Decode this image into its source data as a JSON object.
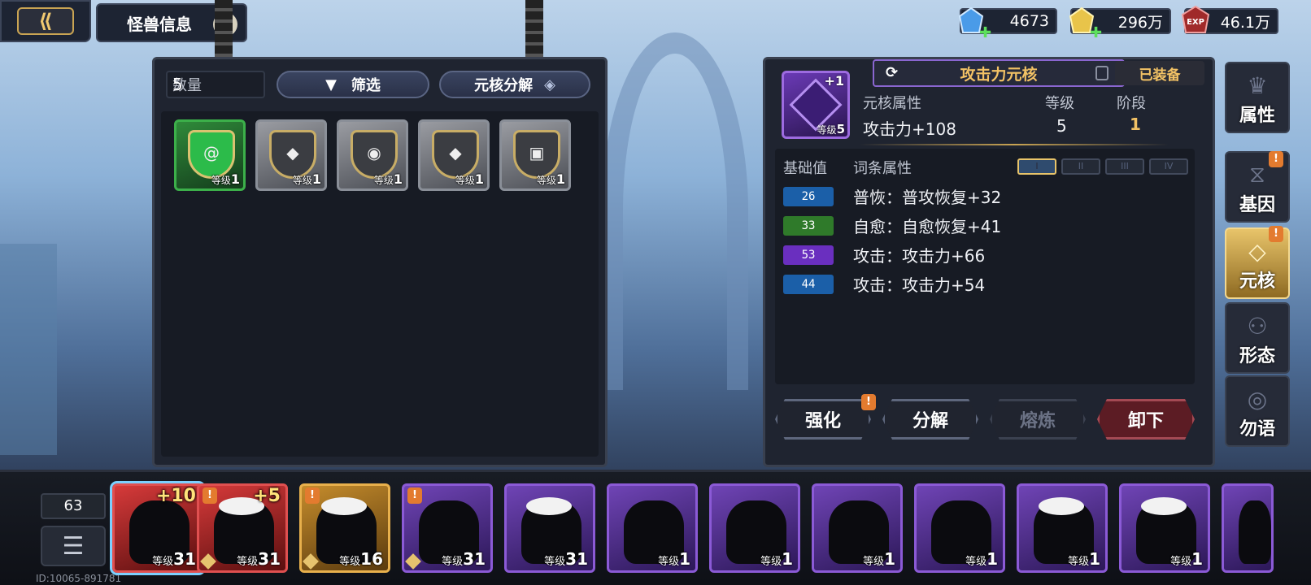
{
  "header": {
    "back_icon": "back-arrow-icon",
    "title": "怪兽信息",
    "info_icon": "i"
  },
  "currencies": [
    {
      "icon": "diamond-gem-icon",
      "value": "4673",
      "color": "#4a9be8"
    },
    {
      "icon": "gold-coin-icon",
      "value": "296万",
      "color": "#e8c44a"
    },
    {
      "icon": "EXP",
      "value": "46.1万",
      "color": "#c23a3a"
    }
  ],
  "inventory": {
    "qty_label": "数量",
    "qty_value": "5",
    "filter_label": "筛选",
    "decompose_label": "元核分解",
    "items": [
      {
        "type": "green",
        "emblem": "@",
        "lv_label": "等级",
        "lv": "1"
      },
      {
        "type": "grey",
        "emblem": "◆",
        "lv_label": "等级",
        "lv": "1"
      },
      {
        "type": "grey",
        "emblem": "◉",
        "lv_label": "等级",
        "lv": "1"
      },
      {
        "type": "grey",
        "emblem": "◆",
        "lv_label": "等级",
        "lv": "1"
      },
      {
        "type": "grey",
        "emblem": "▣",
        "lv_label": "等级",
        "lv": "1"
      }
    ]
  },
  "detail": {
    "core_name": "攻击力元核",
    "equipped_label": "已装备",
    "core_plus": "+1",
    "core_lv_label": "等级",
    "core_lv": "5",
    "attr_header": "元核属性",
    "level_header": "等级",
    "stage_header": "阶段",
    "attr_value": "攻击力+108",
    "level_value": "5",
    "stage_value": "1",
    "base_header": "基础值",
    "affix_header": "词条属性",
    "tiers": [
      "I",
      "II",
      "III",
      "IV"
    ],
    "affixes": [
      {
        "base": "26",
        "color": "#1b5fa8",
        "text": "普恢：普攻恢复+32"
      },
      {
        "base": "33",
        "color": "#2f7a2a",
        "text": "自愈：自愈恢复+41"
      },
      {
        "base": "53",
        "color": "#6a2fbf",
        "text": "攻击：攻击力+66"
      },
      {
        "base": "44",
        "color": "#1b5fa8",
        "text": "攻击：攻击力+54"
      }
    ],
    "buttons": {
      "strengthen": "强化",
      "decompose": "分解",
      "smelt": "熔炼",
      "unequip": "卸下"
    }
  },
  "side_tabs": [
    {
      "label": "属性",
      "icon": "attribute-icon",
      "alert": false
    },
    {
      "label": "基因",
      "icon": "dna-icon",
      "alert": true
    },
    {
      "label": "元核",
      "icon": "core-icon",
      "alert": true
    },
    {
      "label": "形态",
      "icon": "form-icon",
      "alert": false
    },
    {
      "label": "勿语",
      "icon": "speech-icon",
      "alert": false
    }
  ],
  "bottom": {
    "count": "63",
    "menu_icon": "list-menu-icon",
    "uid": "ID:10065-891781",
    "cards": [
      {
        "style": "red",
        "plus": "+10",
        "lv_label": "等级",
        "lv": "31",
        "alert": false,
        "selected": true
      },
      {
        "style": "red",
        "plus": "+5",
        "lv_label": "等级",
        "lv": "31",
        "alert": true,
        "selected": false
      },
      {
        "style": "gold",
        "plus": "",
        "lv_label": "等级",
        "lv": "16",
        "alert": true,
        "selected": false
      },
      {
        "style": "purple",
        "plus": "",
        "lv_label": "等级",
        "lv": "31",
        "alert": true,
        "selected": false
      },
      {
        "style": "purple",
        "plus": "",
        "lv_label": "等级",
        "lv": "31",
        "alert": false,
        "selected": false
      },
      {
        "style": "purple",
        "plus": "",
        "lv_label": "等级",
        "lv": "1",
        "alert": false,
        "selected": false
      },
      {
        "style": "purple",
        "plus": "",
        "lv_label": "等级",
        "lv": "1",
        "alert": false,
        "selected": false
      },
      {
        "style": "purple",
        "plus": "",
        "lv_label": "等级",
        "lv": "1",
        "alert": false,
        "selected": false
      },
      {
        "style": "purple",
        "plus": "",
        "lv_label": "等级",
        "lv": "1",
        "alert": false,
        "selected": false
      },
      {
        "style": "purple",
        "plus": "",
        "lv_label": "等级",
        "lv": "1",
        "alert": false,
        "selected": false
      },
      {
        "style": "purple",
        "plus": "",
        "lv_label": "等级",
        "lv": "1",
        "alert": false,
        "selected": false
      },
      {
        "style": "purple",
        "plus": "",
        "lv_label": "",
        "lv": "",
        "alert": false,
        "selected": false
      }
    ]
  }
}
